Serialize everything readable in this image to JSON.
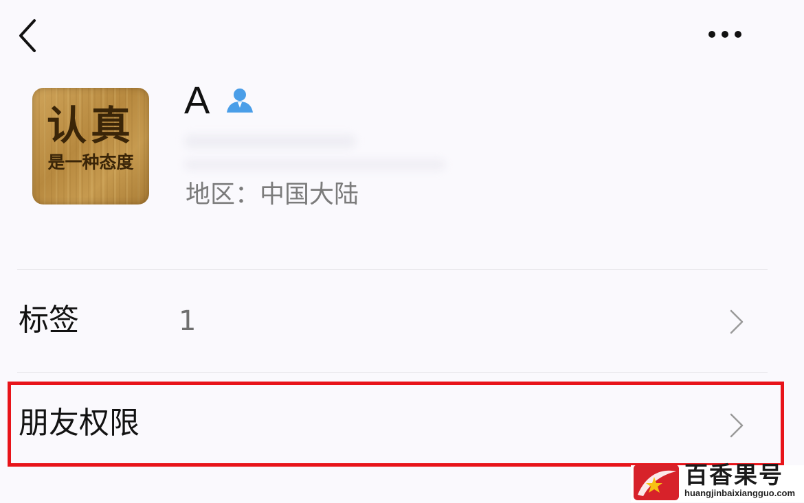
{
  "header": {
    "back_icon": "chevron-left-icon",
    "more_icon": "more-horizontal-icon"
  },
  "profile": {
    "avatar_text_large": "认真",
    "avatar_text_small": "是一种态度",
    "name": "A",
    "badge_icon": "person-badge-icon",
    "badge_color": "#4a9ee8",
    "region_label": "地区：",
    "region_value": "中国大陆"
  },
  "rows": [
    {
      "label": "标签",
      "value": "1",
      "icon": "chevron-right-icon"
    },
    {
      "label": "朋友权限",
      "value": "",
      "icon": "chevron-right-icon",
      "highlighted": true
    }
  ],
  "highlight_color": "#e8141a",
  "watermark": {
    "title": "百香果号",
    "url": "huangjinbaixiangguo.com",
    "logo_icon": "star-logo-icon"
  }
}
